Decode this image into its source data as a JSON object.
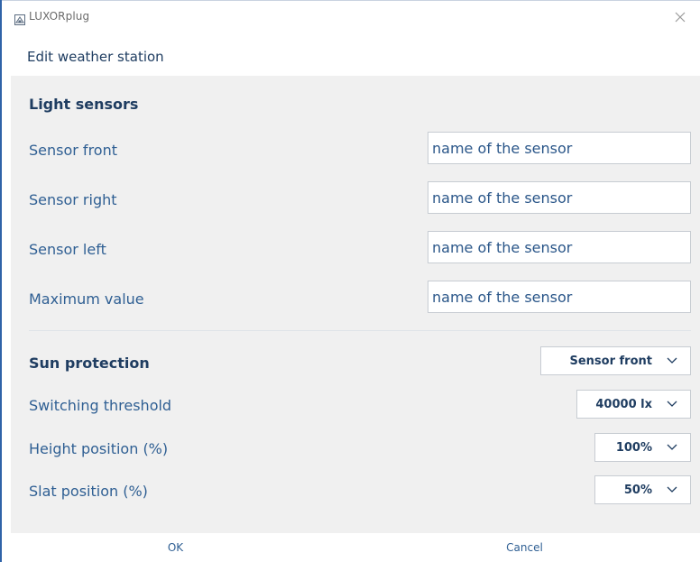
{
  "window": {
    "app_title": "LUXORplug",
    "dialog_title": "Edit weather station",
    "close_icon": "close-icon",
    "app_icon": "luxorplug-icon"
  },
  "light_sensors": {
    "header": "Light sensors",
    "rows": [
      {
        "label": "Sensor front",
        "value": "name of the sensor"
      },
      {
        "label": "Sensor right",
        "value": "name of the sensor"
      },
      {
        "label": "Sensor left",
        "value": "name of the sensor"
      },
      {
        "label": "Maximum value",
        "value": "name of the sensor"
      }
    ]
  },
  "sun_protection": {
    "header": "Sun protection",
    "sensor_select": "Sensor front",
    "rows": [
      {
        "label": "Switching threshold",
        "value": "40000 lx"
      },
      {
        "label": "Height position (%)",
        "value": "100%"
      },
      {
        "label": "Slat position (%)",
        "value": "50%"
      }
    ]
  },
  "footer": {
    "ok_label": "OK",
    "cancel_label": "Cancel"
  },
  "colors": {
    "accent_border": "#2f63a8",
    "label_text": "#2f5f93",
    "header_text": "#1f3d61",
    "panel_bg": "#f0f0f0"
  }
}
